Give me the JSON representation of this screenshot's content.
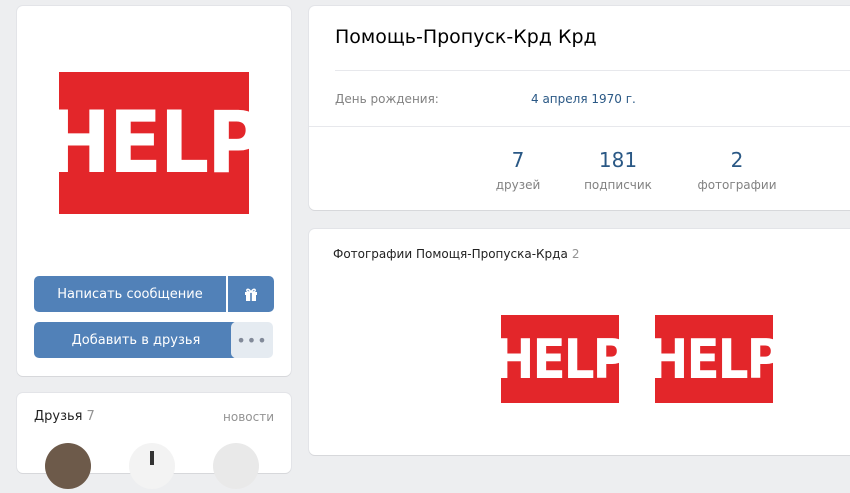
{
  "profile": {
    "avatar_text": "HELP",
    "send_message_label": "Написать сообщение",
    "add_friend_label": "Добавить в друзья",
    "more_label": "•••",
    "gift_icon": "gift-icon"
  },
  "friends": {
    "title": "Друзья",
    "count": "7",
    "news_link": "новости"
  },
  "info": {
    "name": "Помощь-Пропуск-Крд Крд",
    "birthday_label": "День рождения:",
    "birthday_value": "4 апреля 1970 г.",
    "stats": [
      {
        "value": "7",
        "label": "друзей"
      },
      {
        "value": "181",
        "label": "подписчик"
      },
      {
        "value": "2",
        "label": "фотографии"
      }
    ]
  },
  "photos": {
    "title": "Фотографии Помощя-Пропуска-Крда",
    "count": "2",
    "items": [
      {
        "text": "HELP"
      },
      {
        "text": "HELP"
      }
    ]
  },
  "colors": {
    "brand_red": "#e3262a",
    "button_blue": "#5181b8",
    "link_blue": "#2a5885"
  }
}
